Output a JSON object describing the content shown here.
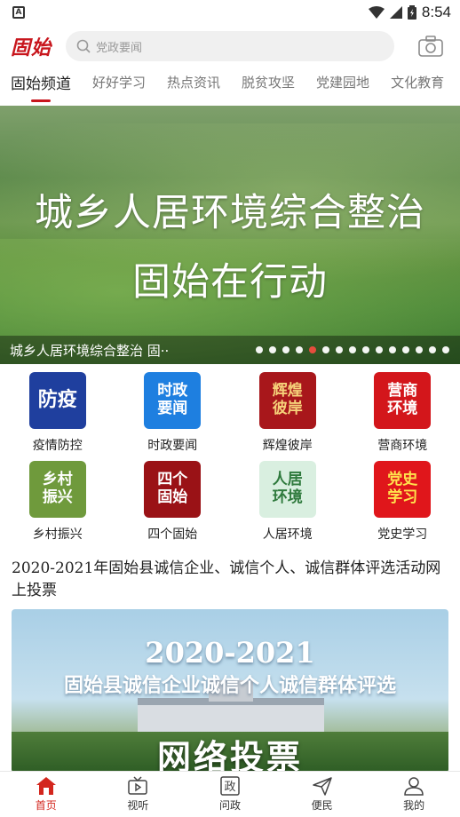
{
  "status_bar": {
    "time": "8:54",
    "app_indicator": "A"
  },
  "header": {
    "logo": "固始",
    "search_placeholder": "党政要闻"
  },
  "tabs": [
    {
      "label": "固始频道",
      "active": true
    },
    {
      "label": "好好学习"
    },
    {
      "label": "热点资讯"
    },
    {
      "label": "脱贫攻坚"
    },
    {
      "label": "党建园地"
    },
    {
      "label": "文化教育"
    }
  ],
  "banner": {
    "line1": "城乡人居环境综合整治",
    "line2": "固始在行动",
    "caption": "城乡人居环境综合整治 固··",
    "dot_count": 15,
    "active_dot": 4
  },
  "grid": [
    {
      "label": "疫情防控",
      "icon_text": "防疫",
      "bg": "#1f3f9e",
      "fg": "#ffffff"
    },
    {
      "label": "时政要闻",
      "icon_text": "时政\n要闻",
      "bg": "#1e7fe0",
      "fg": "#ffffff"
    },
    {
      "label": "辉煌彼岸",
      "icon_text": "辉煌\n彼岸",
      "bg": "#a8171b",
      "fg": "#f6d27a"
    },
    {
      "label": "营商环境",
      "icon_text": "营商\n环境",
      "bg": "#d3161b",
      "fg": "#ffffff"
    },
    {
      "label": "乡村振兴",
      "icon_text": "乡村\n振兴",
      "bg": "#6f9a3c",
      "fg": "#ffffff"
    },
    {
      "label": "四个固始",
      "icon_text": "四个\n固始",
      "bg": "#9a1216",
      "fg": "#ffffff"
    },
    {
      "label": "人居环境",
      "icon_text": "人居\n环境",
      "bg": "#d9efe0",
      "fg": "#2f7a3d"
    },
    {
      "label": "党史学习",
      "icon_text": "党史\n学习",
      "bg": "#e0161b",
      "fg": "#ffe34d"
    }
  ],
  "article": {
    "title": "2020-2021年固始县诚信企业、诚信个人、诚信群体评选活动网上投票",
    "image_line1": "2020-2021",
    "image_line2": "固始县诚信企业诚信个人诚信群体评选",
    "image_line3": "网络投票"
  },
  "bottom_nav": [
    {
      "label": "首页",
      "icon": "home-icon",
      "active": true
    },
    {
      "label": "视听",
      "icon": "tv-icon"
    },
    {
      "label": "问政",
      "icon": "zheng-icon",
      "glyph": "政"
    },
    {
      "label": "便民",
      "icon": "send-icon"
    },
    {
      "label": "我的",
      "icon": "user-icon"
    }
  ],
  "colors": {
    "accent": "#c8161d",
    "nav_active": "#d3261d"
  }
}
